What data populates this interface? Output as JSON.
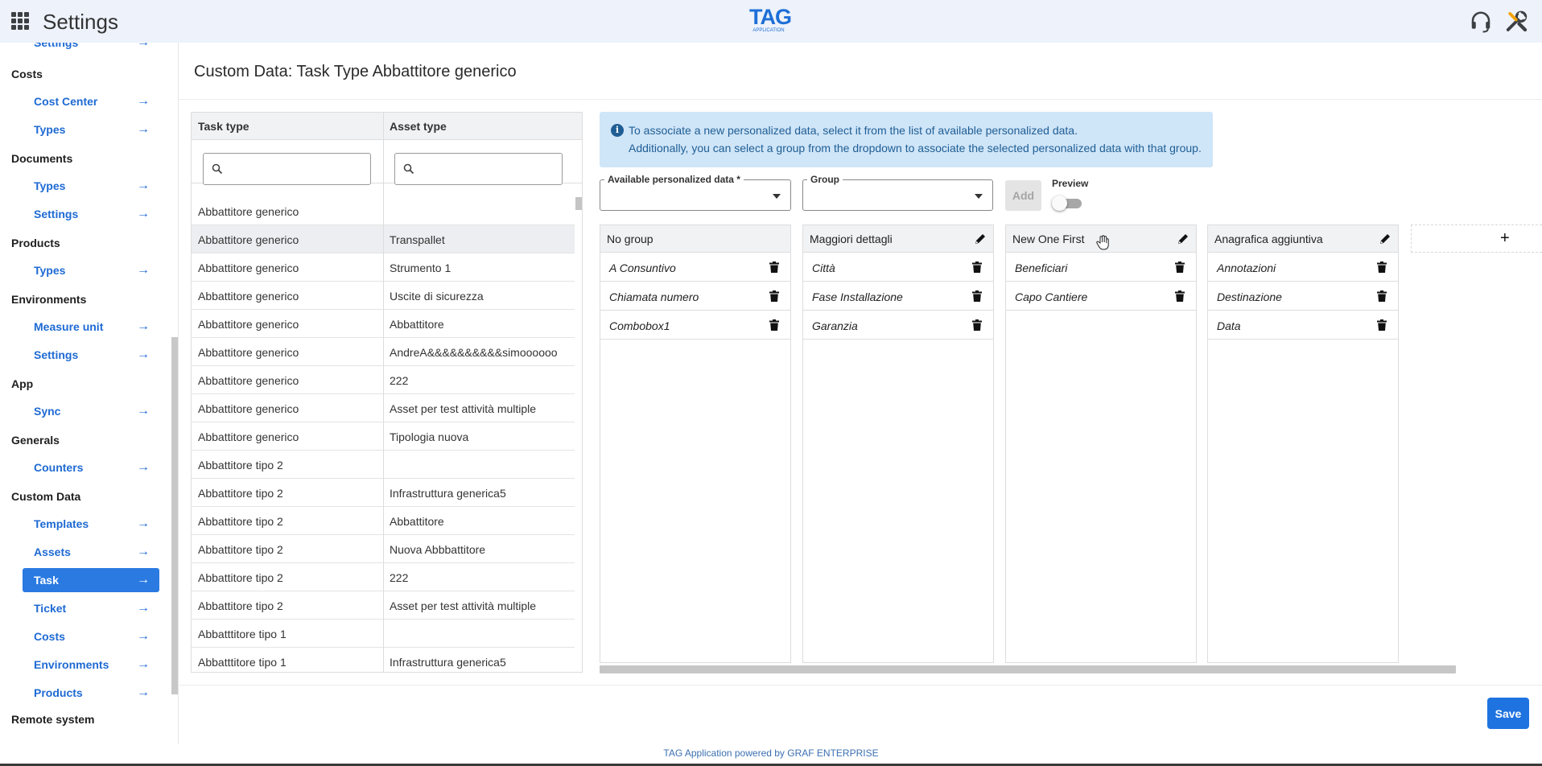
{
  "header": {
    "title": "Settings",
    "brand": "TAG",
    "brand_sub": "APPLICATION"
  },
  "sidebar": {
    "partial_top": "Settings",
    "sections": {
      "costs": "Costs",
      "documents": "Documents",
      "products": "Products",
      "environments": "Environments",
      "app": "App",
      "generals": "Generals",
      "custom_data": "Custom Data",
      "remote_system": "Remote system"
    },
    "items": {
      "cost_center": "Cost Center",
      "costs_types": "Types",
      "documents_types": "Types",
      "documents_settings": "Settings",
      "products_types": "Types",
      "measure_unit": "Measure unit",
      "environments_settings": "Settings",
      "sync": "Sync",
      "counters": "Counters",
      "templates": "Templates",
      "assets": "Assets",
      "task": "Task",
      "ticket": "Ticket",
      "cd_costs": "Costs",
      "cd_environments": "Environments",
      "cd_products": "Products"
    },
    "arrow": "→"
  },
  "page": {
    "title": "Custom Data: Task Type Abbattitore generico"
  },
  "table": {
    "columns": [
      "Task type",
      "Asset type"
    ],
    "rows": [
      [
        "Abbattitore generico",
        ""
      ],
      [
        "Abbattitore generico",
        "Transpallet"
      ],
      [
        "Abbattitore generico",
        "Strumento 1"
      ],
      [
        "Abbattitore generico",
        "Uscite di sicurezza"
      ],
      [
        "Abbattitore generico",
        "Abbattitore"
      ],
      [
        "Abbattitore generico",
        "AndreA&&&&&&&&&&simoooooo"
      ],
      [
        "Abbattitore generico",
        "222"
      ],
      [
        "Abbattitore generico",
        "Asset per test attività multiple"
      ],
      [
        "Abbattitore generico",
        "Tipologia nuova"
      ],
      [
        "Abbattitore tipo 2",
        ""
      ],
      [
        "Abbattitore tipo 2",
        "Infrastruttura generica5"
      ],
      [
        "Abbattitore tipo 2",
        "Abbattitore"
      ],
      [
        "Abbattitore tipo 2",
        "Nuova Abbbattitore"
      ],
      [
        "Abbattitore tipo 2",
        "222"
      ],
      [
        "Abbattitore tipo 2",
        "Asset per test attività multiple"
      ],
      [
        "Abbatttitore tipo 1",
        ""
      ],
      [
        "Abbatttitore tipo 1",
        "Infrastruttura generica5"
      ]
    ],
    "highlighted_row": 1
  },
  "info": {
    "line1": "To associate a new personalized data, select it from the list of available personalized data.",
    "line2": "Additionally, you can select a group from the dropdown to associate the selected personalized data with that group.",
    "icon": "i"
  },
  "form": {
    "available_label": "Available personalized data *",
    "group_label": "Group",
    "add_label": "Add",
    "preview_label": "Preview"
  },
  "groups": [
    {
      "name": "No group",
      "editable": false,
      "items": [
        "A Consuntivo",
        "Chiamata numero",
        "Combobox1"
      ]
    },
    {
      "name": "Maggiori dettagli",
      "editable": true,
      "items": [
        "Città",
        "Fase Installazione",
        "Garanzia"
      ]
    },
    {
      "name": "New One First",
      "editable": true,
      "items": [
        "Beneficiari",
        "Capo Cantiere"
      ]
    },
    {
      "name": "Anagrafica aggiuntiva",
      "editable": true,
      "items": [
        "Annotazioni",
        "Destinazione",
        "Data"
      ]
    }
  ],
  "add_group_symbol": "+",
  "save_label": "Save",
  "footer": "TAG Application powered by GRAF ENTERPRISE",
  "colors": {
    "accent": "#1f73e0",
    "header_bg": "#edf2fb",
    "info_bg": "#cfe5f8"
  }
}
